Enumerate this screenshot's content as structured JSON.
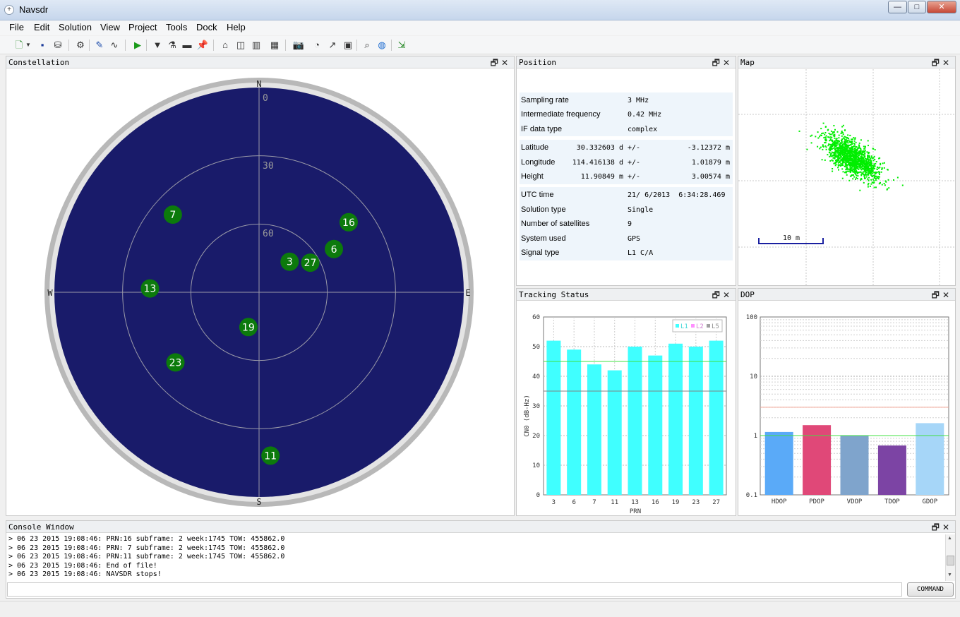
{
  "window": {
    "title": "Navsdr",
    "icon": "app-icon",
    "min": "—",
    "max": "□",
    "close": "✕"
  },
  "menu": [
    "File",
    "Edit",
    "Solution",
    "View",
    "Project",
    "Tools",
    "Dock",
    "Help"
  ],
  "toolbar_icons": [
    "new-file-icon",
    "dropdown-icon",
    "save-icon",
    "database-icon",
    "settings-icon",
    "pen-icon",
    "wave-icon",
    "play-icon",
    "filter-icon",
    "flask-icon",
    "ruler-icon",
    "pin-icon",
    "home-icon",
    "layout-icon",
    "split-icon",
    "grid-icon",
    "camera-icon",
    "dial-icon",
    "chart-axis-icon",
    "map-icon",
    "search-icon",
    "globe-icon",
    "export-icon"
  ],
  "panels": {
    "constellation": "Constellation",
    "position": "Position",
    "map": "Map",
    "tracking": "Tracking Status",
    "dop": "DOP",
    "console": "Console Window",
    "float_icon": "🗗",
    "close_icon": "✕"
  },
  "constellation": {
    "directions": {
      "n": "N",
      "s": "S",
      "e": "E",
      "w": "W"
    },
    "elevation_labels": [
      "0",
      "30",
      "60"
    ],
    "satellites": [
      {
        "prn": "7",
        "az": 312,
        "el": 39
      },
      {
        "prn": "16",
        "az": 52,
        "el": 40
      },
      {
        "prn": "6",
        "az": 60,
        "el": 52
      },
      {
        "prn": "27",
        "az": 60,
        "el": 64
      },
      {
        "prn": "3",
        "az": 45,
        "el": 71
      },
      {
        "prn": "13",
        "az": 272,
        "el": 42
      },
      {
        "prn": "19",
        "az": 197,
        "el": 74
      },
      {
        "prn": "23",
        "az": 230,
        "el": 42
      },
      {
        "prn": "11",
        "az": 176,
        "el": 18
      }
    ]
  },
  "position": {
    "config": [
      {
        "label": "Sampling rate",
        "value": "3 MHz"
      },
      {
        "label": "Intermediate frequency",
        "value": "0.42 MHz"
      },
      {
        "label": "IF data type",
        "value": "complex"
      }
    ],
    "coords": [
      {
        "label": "Latitude",
        "value": "30.332603 d",
        "pm": "+/-",
        "err": "-3.12372 m"
      },
      {
        "label": "Longitude",
        "value": "114.416138 d",
        "pm": "+/-",
        "err": "1.01879 m"
      },
      {
        "label": "Height",
        "value": "11.90849 m",
        "pm": "+/-",
        "err": "3.00574 m"
      }
    ],
    "status": [
      {
        "label": "UTC time",
        "value": "21/ 6/2013  6:34:28.469"
      },
      {
        "label": "Solution type",
        "value": "Single"
      },
      {
        "label": "Number of satellites",
        "value": "9"
      },
      {
        "label": "System used",
        "value": "GPS"
      },
      {
        "label": "Signal type",
        "value": "L1 C/A"
      }
    ]
  },
  "map": {
    "scale_label": "10 m",
    "point_color": "#00ee00"
  },
  "chart_data": [
    {
      "type": "bar",
      "categories": [
        "3",
        "6",
        "7",
        "11",
        "13",
        "16",
        "19",
        "23",
        "27"
      ],
      "series": [
        {
          "name": "L1",
          "values": [
            52,
            49,
            44,
            42,
            50,
            47,
            51,
            50,
            52
          ]
        }
      ],
      "legend_names": [
        "L1",
        "L2",
        "L5"
      ],
      "legend_colors": [
        "#40ffff",
        "#ff90ff",
        "#a0a0a0"
      ],
      "xlabel": "PRN",
      "ylabel": "CN0 (dB-Hz)",
      "ylim": [
        0,
        60
      ],
      "yticks": [
        "0",
        "10",
        "20",
        "30",
        "40",
        "50",
        "60"
      ],
      "reference_lines": [
        45,
        35
      ],
      "grid": true,
      "legend_position": "top-right"
    },
    {
      "type": "bar",
      "categories": [
        "HDOP",
        "PDOP",
        "VDOP",
        "TDOP",
        "GDOP"
      ],
      "values": [
        1.15,
        1.5,
        1.0,
        0.68,
        1.62
      ],
      "colors": [
        "#5aaaf8",
        "#e04878",
        "#7fa4cc",
        "#7c44a4",
        "#a6d6f8"
      ],
      "yscale": "log",
      "ylim": [
        0.1,
        100
      ],
      "yticks": [
        "0.1",
        "1",
        "10",
        "100"
      ],
      "reference_lines": [
        3,
        1
      ],
      "grid": true
    }
  ],
  "console": {
    "lines": [
      "> 06 23 2015 19:08:46: PRN:16 subframe: 2 week:1745 TOW: 455862.0",
      "> 06 23 2015 19:08:46: PRN: 7 subframe: 2 week:1745 TOW: 455862.0",
      "> 06 23 2015 19:08:46: PRN:11 subframe: 2 week:1745 TOW: 455862.0",
      "> 06 23 2015 19:08:46: End of file!",
      "> 06 23 2015 19:08:46: NAVSDR stops!"
    ],
    "command_label": "COMMAND",
    "command_value": ""
  }
}
